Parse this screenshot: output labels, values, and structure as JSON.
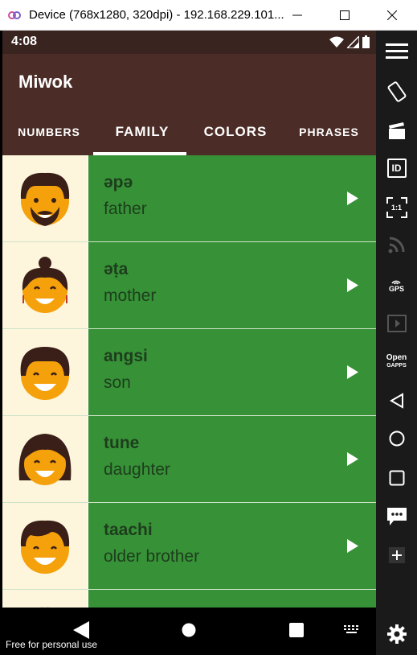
{
  "window": {
    "title": "Device (768x1280, 320dpi) - 192.168.229.101..."
  },
  "statusbar": {
    "time": "4:08"
  },
  "app": {
    "title": "Miwok"
  },
  "tabs": [
    {
      "label": "NUMBERS",
      "selected": false
    },
    {
      "label": "FAMILY",
      "selected": true
    },
    {
      "label": "COLORS",
      "selected": false
    },
    {
      "label": "PHRASES",
      "selected": false
    }
  ],
  "words": [
    {
      "miwok": "əpə",
      "english": "father",
      "icon": "father-face-icon"
    },
    {
      "miwok": "əṭa",
      "english": "mother",
      "icon": "mother-face-icon"
    },
    {
      "miwok": "angsi",
      "english": "son",
      "icon": "son-face-icon"
    },
    {
      "miwok": "tune",
      "english": "daughter",
      "icon": "daughter-face-icon"
    },
    {
      "miwok": "taachi",
      "english": "older brother",
      "icon": "older-brother-face-icon"
    }
  ],
  "sidebar": {
    "gps_label": "GPS",
    "gapps_label_1": "Open",
    "gapps_label_2": "GAPPS",
    "scale_label": "1:1",
    "id_label": "ID"
  },
  "navbar": {
    "watermark": "Free for personal use"
  },
  "colors": {
    "appbar": "#4b2c26",
    "statusbar": "#3a2420",
    "row_green": "#379237",
    "avatar_bg": "#fdf6dc",
    "face": "#f5a10b",
    "hair": "#3a1f18"
  }
}
